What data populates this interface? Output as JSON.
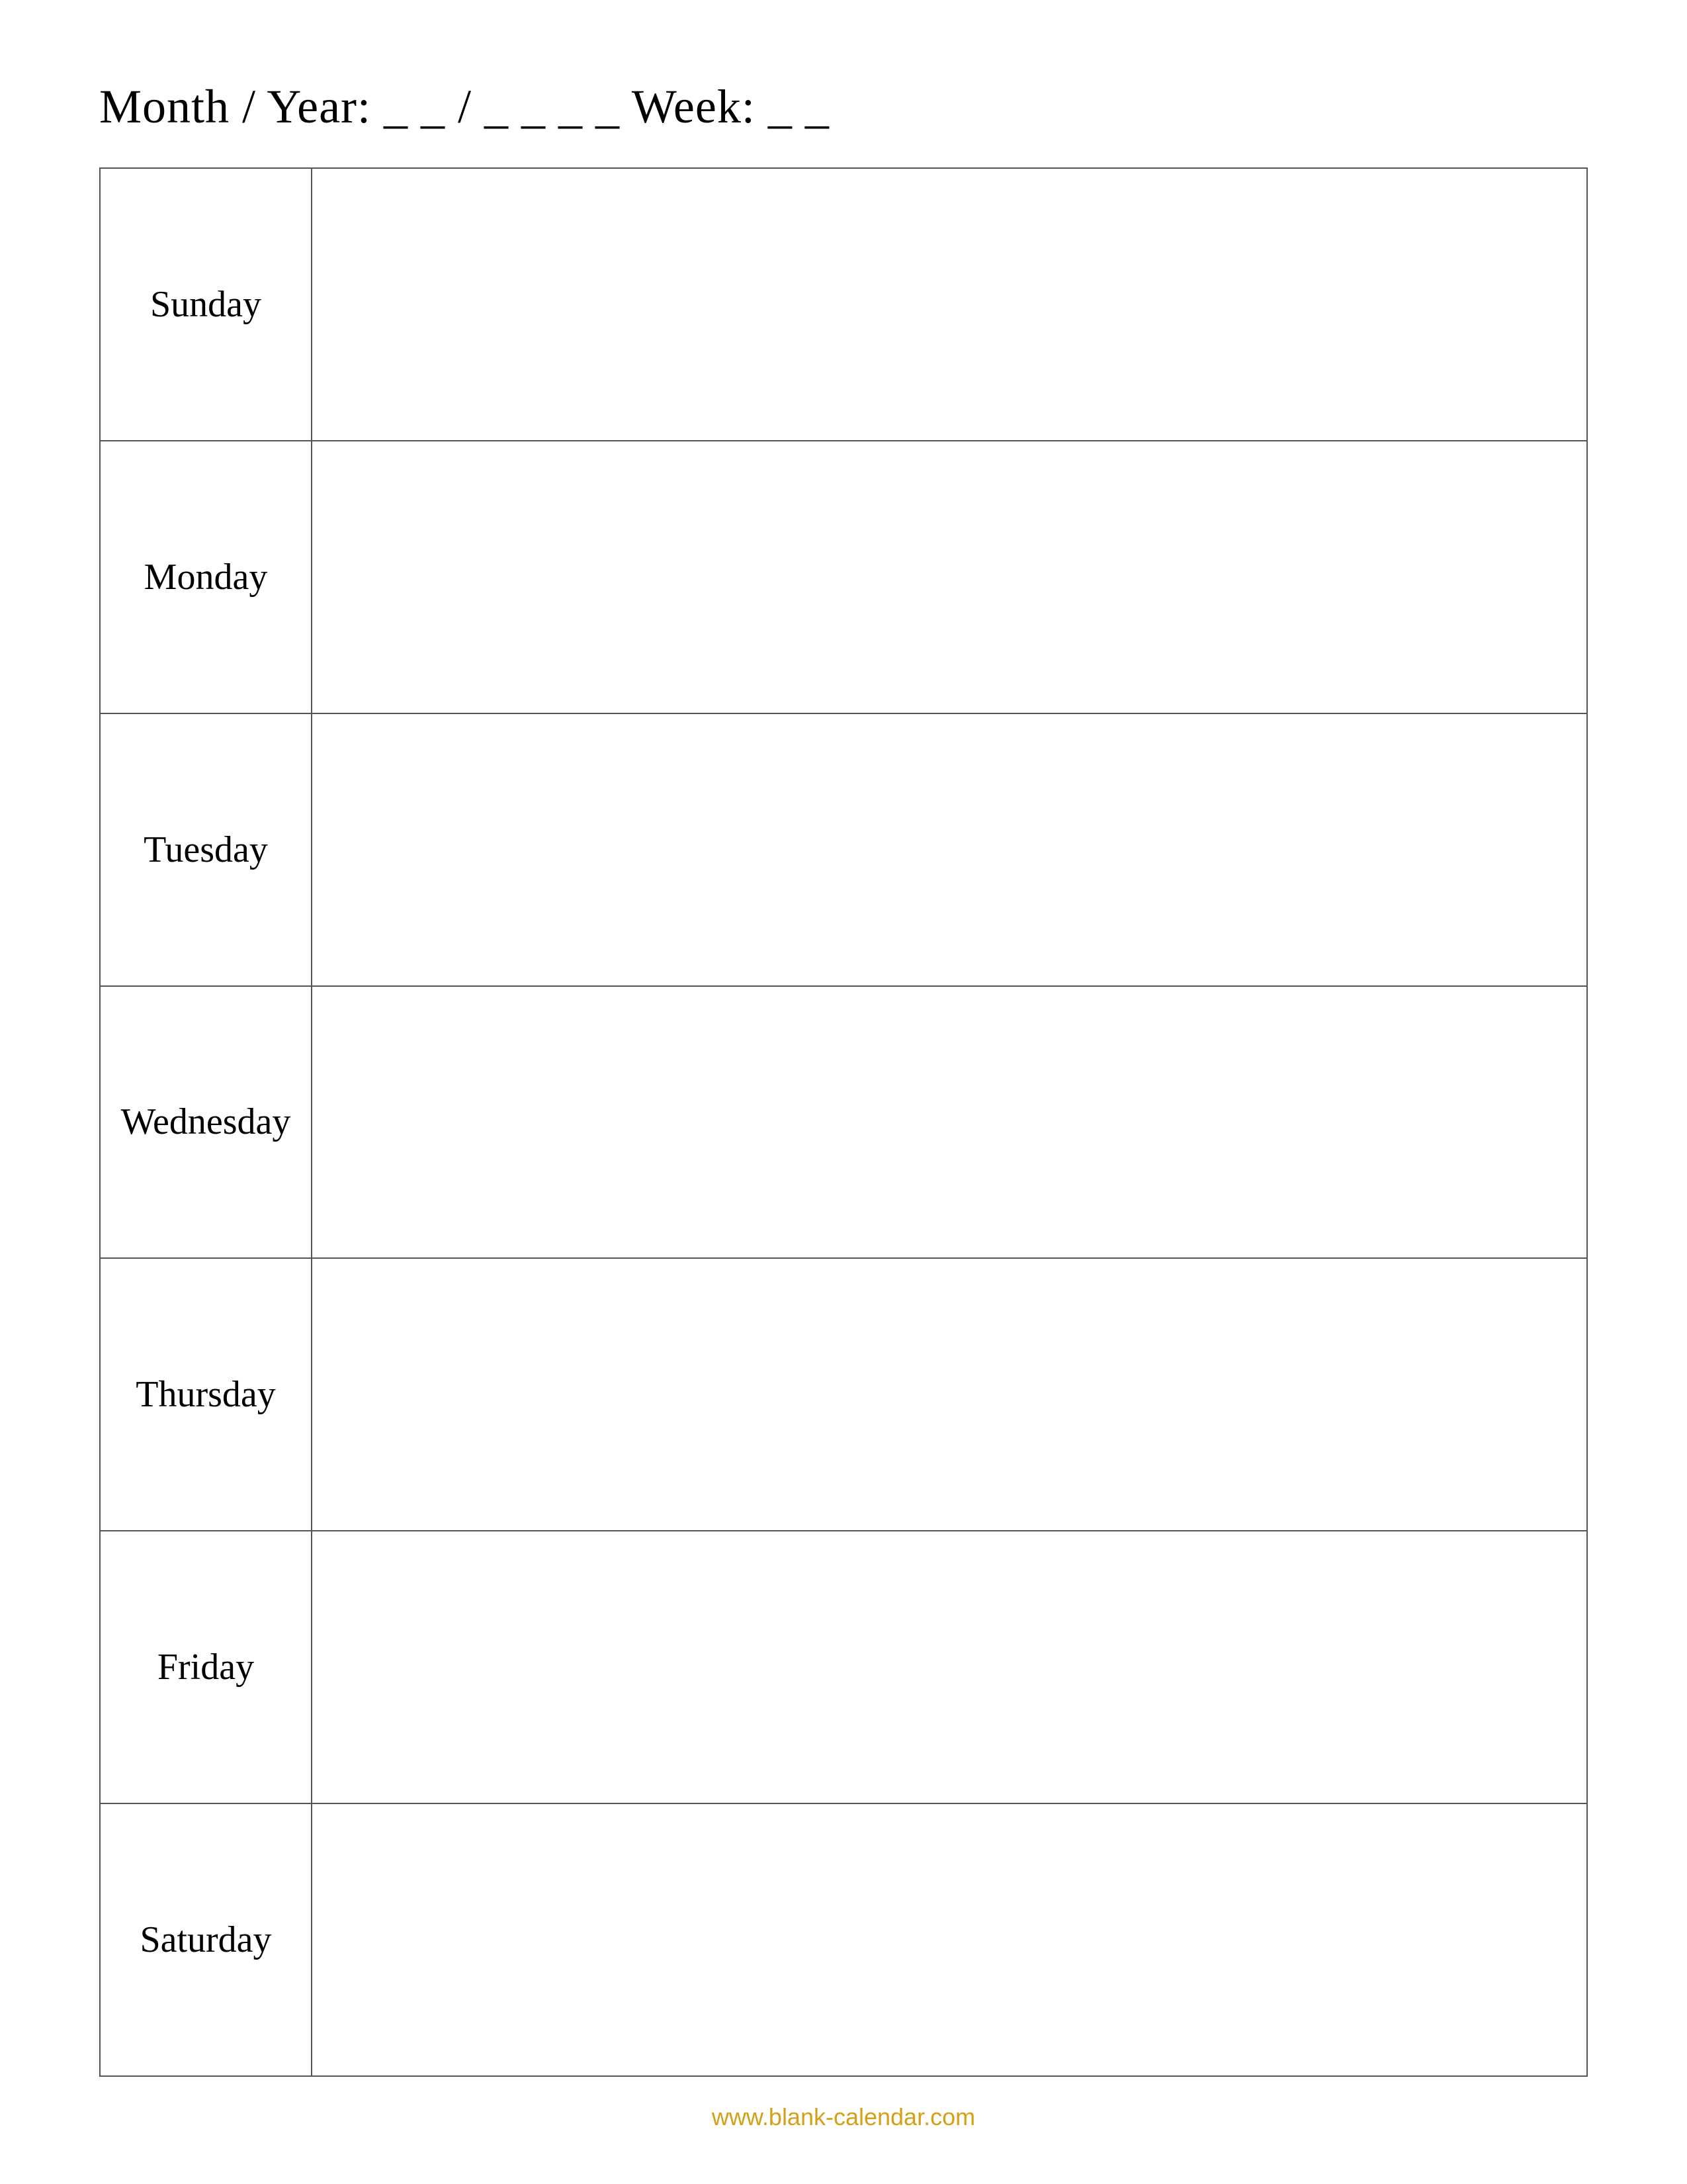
{
  "header": {
    "label": "Month / Year: _ _ / _ _ _ _   Week: _ _"
  },
  "days": [
    {
      "name": "Sunday"
    },
    {
      "name": "Monday"
    },
    {
      "name": "Tuesday"
    },
    {
      "name": "Wednesday"
    },
    {
      "name": "Thursday"
    },
    {
      "name": "Friday"
    },
    {
      "name": "Saturday"
    }
  ],
  "footer": {
    "url": "www.blank-calendar.com"
  }
}
